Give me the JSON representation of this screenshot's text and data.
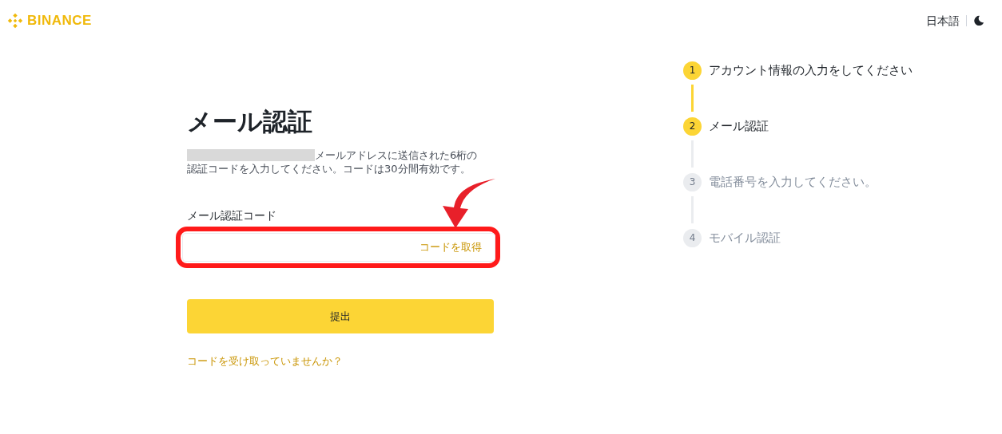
{
  "header": {
    "logo_text": "BINANCE",
    "language": "日本語"
  },
  "form": {
    "title": "メール認証",
    "description_lines": [
      "メールアドレスに送信された6桁の",
      "認証コードを入力してください。コードは30分間有効です。"
    ],
    "field_label": "メール認証コード",
    "field_action": "コードを取得",
    "submit": "提出",
    "help_link": "コードを受け取っていませんか？"
  },
  "steps": [
    {
      "number": "1",
      "label": "アカウント情報の入力をしてください",
      "active": true
    },
    {
      "number": "2",
      "label": "メール認証",
      "active": true
    },
    {
      "number": "3",
      "label": "電話番号を入力してください。",
      "active": false
    },
    {
      "number": "4",
      "label": "モバイル認証",
      "active": false
    }
  ]
}
